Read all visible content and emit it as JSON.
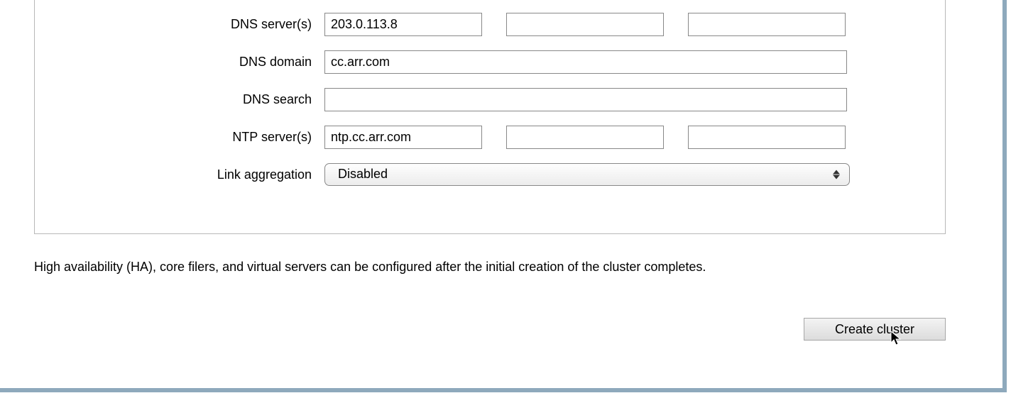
{
  "form": {
    "dns_servers": {
      "label": "DNS server(s)",
      "values": [
        "203.0.113.8",
        "",
        ""
      ]
    },
    "dns_domain": {
      "label": "DNS domain",
      "value": "cc.arr.com"
    },
    "dns_search": {
      "label": "DNS search",
      "value": ""
    },
    "ntp_servers": {
      "label": "NTP server(s)",
      "values": [
        "ntp.cc.arr.com",
        "",
        ""
      ]
    },
    "link_aggregation": {
      "label": "Link aggregation",
      "selected": "Disabled"
    }
  },
  "note": "High availability (HA), core filers, and virtual servers can be configured after the initial creation of the cluster completes.",
  "actions": {
    "create_cluster": "Create cluster"
  }
}
